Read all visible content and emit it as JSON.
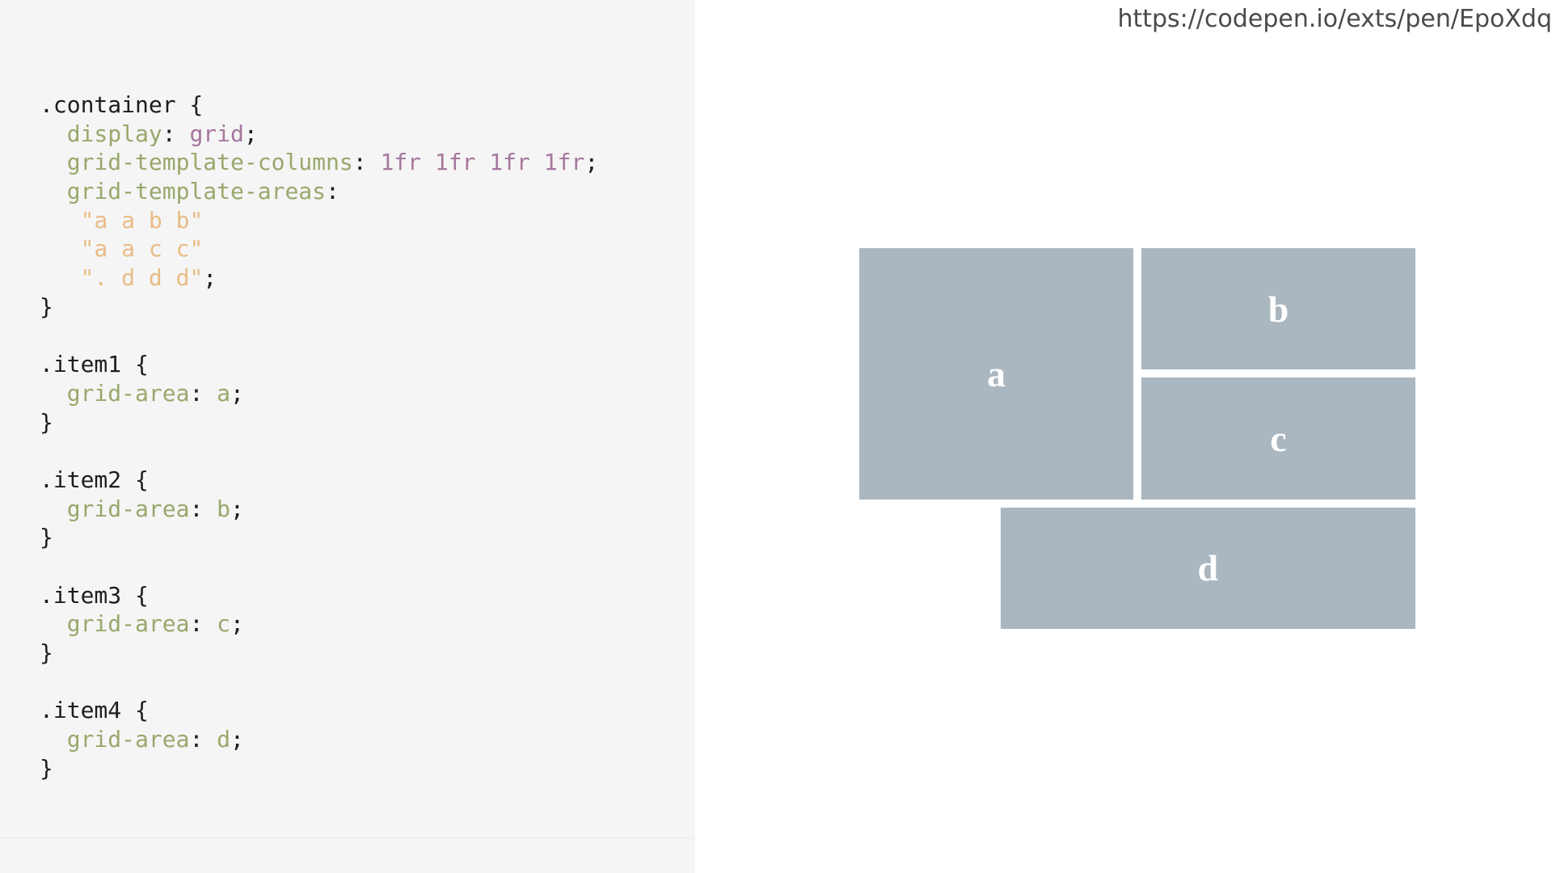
{
  "url": "https://codepen.io/exts/pen/EpoXdq",
  "colors": {
    "panel_background": "#f5f5f5",
    "property": "#98a86c",
    "value": "#a6779e",
    "string": "#e9bc86",
    "text": "#1d1d1d",
    "grid_item": "#aab7c1"
  },
  "code": [
    [
      {
        "t": ".container {",
        "c": "plain"
      }
    ],
    [
      {
        "t": "  ",
        "c": "plain"
      },
      {
        "t": "display",
        "c": "prop"
      },
      {
        "t": ": ",
        "c": "plain"
      },
      {
        "t": "grid",
        "c": "val"
      },
      {
        "t": ";",
        "c": "plain"
      }
    ],
    [
      {
        "t": "  ",
        "c": "plain"
      },
      {
        "t": "grid-template-columns",
        "c": "prop"
      },
      {
        "t": ": ",
        "c": "plain"
      },
      {
        "t": "1fr 1fr 1fr 1fr",
        "c": "val"
      },
      {
        "t": ";",
        "c": "plain"
      }
    ],
    [
      {
        "t": "  ",
        "c": "plain"
      },
      {
        "t": "grid-template-areas",
        "c": "prop"
      },
      {
        "t": ":",
        "c": "plain"
      }
    ],
    [
      {
        "t": "   ",
        "c": "plain"
      },
      {
        "t": "\"a a b b\"",
        "c": "str"
      }
    ],
    [
      {
        "t": "   ",
        "c": "plain"
      },
      {
        "t": "\"a a c c\"",
        "c": "str"
      }
    ],
    [
      {
        "t": "   ",
        "c": "plain"
      },
      {
        "t": "\". d d d\"",
        "c": "str"
      },
      {
        "t": ";",
        "c": "plain"
      }
    ],
    [
      {
        "t": "}",
        "c": "plain"
      }
    ],
    [],
    [
      {
        "t": ".item1 {",
        "c": "plain"
      }
    ],
    [
      {
        "t": "  ",
        "c": "plain"
      },
      {
        "t": "grid-area",
        "c": "prop"
      },
      {
        "t": ": ",
        "c": "plain"
      },
      {
        "t": "a",
        "c": "prop"
      },
      {
        "t": ";",
        "c": "plain"
      }
    ],
    [
      {
        "t": "}",
        "c": "plain"
      }
    ],
    [],
    [
      {
        "t": ".item2 {",
        "c": "plain"
      }
    ],
    [
      {
        "t": "  ",
        "c": "plain"
      },
      {
        "t": "grid-area",
        "c": "prop"
      },
      {
        "t": ": ",
        "c": "plain"
      },
      {
        "t": "b",
        "c": "prop"
      },
      {
        "t": ";",
        "c": "plain"
      }
    ],
    [
      {
        "t": "}",
        "c": "plain"
      }
    ],
    [],
    [
      {
        "t": ".item3 {",
        "c": "plain"
      }
    ],
    [
      {
        "t": "  ",
        "c": "plain"
      },
      {
        "t": "grid-area",
        "c": "prop"
      },
      {
        "t": ": ",
        "c": "plain"
      },
      {
        "t": "c",
        "c": "prop"
      },
      {
        "t": ";",
        "c": "plain"
      }
    ],
    [
      {
        "t": "}",
        "c": "plain"
      }
    ],
    [],
    [
      {
        "t": ".item4 {",
        "c": "plain"
      }
    ],
    [
      {
        "t": "  ",
        "c": "plain"
      },
      {
        "t": "grid-area",
        "c": "prop"
      },
      {
        "t": ": ",
        "c": "plain"
      },
      {
        "t": "d",
        "c": "prop"
      },
      {
        "t": ";",
        "c": "plain"
      }
    ],
    [
      {
        "t": "}",
        "c": "plain"
      }
    ]
  ],
  "grid": {
    "columns": 4,
    "areas": [
      "a a b b",
      "a a c c",
      ". d d d"
    ],
    "items": [
      {
        "area": "a",
        "label": "a"
      },
      {
        "area": "b",
        "label": "b"
      },
      {
        "area": "c",
        "label": "c"
      },
      {
        "area": "d",
        "label": "d"
      }
    ]
  }
}
